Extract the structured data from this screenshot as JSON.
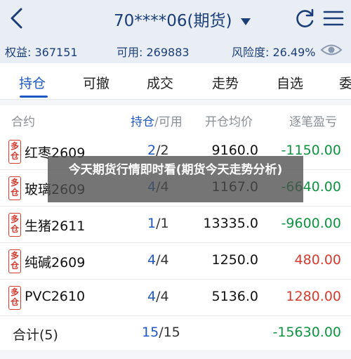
{
  "header": {
    "title": "70****06(期货)",
    "back_icon": "back-chevron-icon",
    "refresh_icon": "refresh-icon",
    "menu_icon": "menu-icon"
  },
  "account": {
    "equity": "权益: 367151",
    "available": "可用: 269883",
    "risk": "风险度: 26.49%",
    "eye_icon": "eye-icon"
  },
  "tabs": [
    {
      "label": "持仓",
      "active": true
    },
    {
      "label": "可撤"
    },
    {
      "label": "成交"
    },
    {
      "label": "走势"
    },
    {
      "label": "自选"
    },
    {
      "label": "委"
    }
  ],
  "table": {
    "headers": {
      "contract": "合约",
      "hold": "持仓",
      "slash_available": "/可用",
      "open_price": "开仓均价",
      "pnl": "逐笔盈亏"
    },
    "rows": [
      {
        "badge_top": "多",
        "badge_bottom": "仓",
        "name": "红枣2609",
        "hold": "2",
        "avail": "/2",
        "price": "9160.0",
        "pnl": "-1150.00",
        "pnl_color": "#0e9440"
      },
      {
        "badge_top": "多",
        "badge_bottom": "仓",
        "name": "玻璃2609",
        "hold": "4",
        "avail": "/4",
        "price": "1167.0",
        "pnl": "-6640.00",
        "pnl_color": "#0e9440"
      },
      {
        "badge_top": "多",
        "badge_bottom": "仓",
        "name": "生猪2611",
        "hold": "1",
        "avail": "/1",
        "price": "13335.0",
        "pnl": "-9600.00",
        "pnl_color": "#0e9440"
      },
      {
        "badge_top": "多",
        "badge_bottom": "仓",
        "name": "纯碱2609",
        "hold": "4",
        "avail": "/4",
        "price": "1250.0",
        "pnl": "480.00",
        "pnl_color": "#d63b2f"
      },
      {
        "badge_top": "多",
        "badge_bottom": "仓",
        "name": "PVC2610",
        "hold": "4",
        "avail": "/4",
        "price": "5136.0",
        "pnl": "1280.00",
        "pnl_color": "#d63b2f"
      }
    ],
    "total": {
      "label": "合计(5)",
      "hold": "15",
      "avail": "/15",
      "pnl": "-15630.00"
    }
  },
  "overlay": {
    "text": "今天期货行情即时看(期货今天走势分析)"
  },
  "colors": {
    "accent": "#1f58c4",
    "loss": "#0e9440",
    "gain": "#d63b2f"
  }
}
